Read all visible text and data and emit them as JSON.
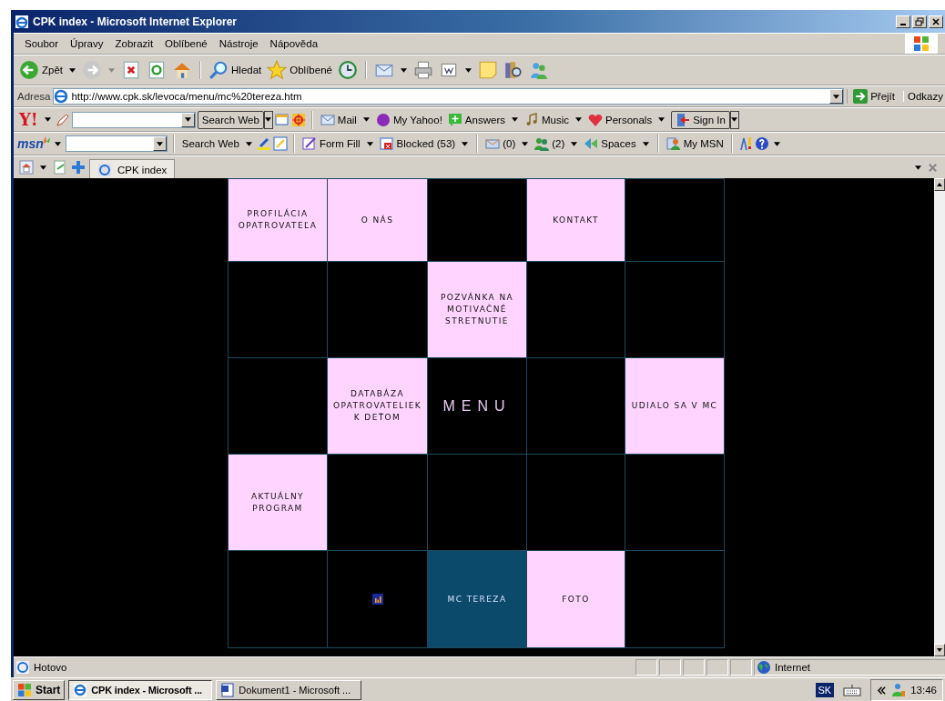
{
  "window": {
    "title": "CPK index - Microsoft Internet Explorer"
  },
  "menu": [
    "Soubor",
    "Úpravy",
    "Zobrazit",
    "Oblíbené",
    "Nástroje",
    "Nápověda"
  ],
  "toolbar": {
    "back": "Zpět",
    "search": "Hledat",
    "favorites": "Oblíbené"
  },
  "address": {
    "label": "Adresa",
    "value": "http://www.cpk.sk/levoca/menu/mc%20tereza.htm",
    "go": "Přejít",
    "links": "Odkazy"
  },
  "yahoo_bar": {
    "logo": "Y!",
    "search_button": "Search Web",
    "items": [
      "Mail",
      "My Yahoo!",
      "Answers",
      "Music",
      "Personals"
    ],
    "sign_in": "Sign In"
  },
  "msn_bar": {
    "logo": "msn",
    "search_button": "Search Web",
    "items": [
      "Form Fill",
      "Blocked (53)",
      "(0)",
      "(2)",
      "Spaces"
    ],
    "my_msn": "My MSN"
  },
  "tabs": [
    {
      "label": "CPK index",
      "selected": true
    }
  ],
  "grid": [
    [
      {
        "kind": "link",
        "text": "PROFILÁCIA OPATROVATEĽA"
      },
      {
        "kind": "link",
        "text": "O NÁS"
      },
      {
        "kind": "empty"
      },
      {
        "kind": "link",
        "text": "KONTAKT"
      },
      {
        "kind": "empty"
      }
    ],
    [
      {
        "kind": "empty"
      },
      {
        "kind": "empty"
      },
      {
        "kind": "link",
        "text": "POZVÁNKA NA MOTIVAČNÉ STRETNUTIE"
      },
      {
        "kind": "empty"
      },
      {
        "kind": "empty"
      }
    ],
    [
      {
        "kind": "empty"
      },
      {
        "kind": "link",
        "text": "DATABÁZA OPATROVATELIEK K DEŤOM"
      },
      {
        "kind": "heading",
        "text": "MENU"
      },
      {
        "kind": "empty"
      },
      {
        "kind": "link",
        "text": "UDIALO SA V MC"
      }
    ],
    [
      {
        "kind": "link",
        "text": "AKTUÁLNY PROGRAM"
      },
      {
        "kind": "empty"
      },
      {
        "kind": "empty"
      },
      {
        "kind": "empty"
      },
      {
        "kind": "empty"
      }
    ],
    [
      {
        "kind": "empty"
      },
      {
        "kind": "counter"
      },
      {
        "kind": "current",
        "text": "MC TEREZA"
      },
      {
        "kind": "link",
        "text": "FOTO"
      },
      {
        "kind": "empty"
      }
    ]
  ],
  "status_bar": {
    "text": "Hotovo",
    "zone": "Internet"
  },
  "taskbar": {
    "start": "Start",
    "tasks": [
      {
        "label": "CPK index - Microsoft ...",
        "selected": true
      },
      {
        "label": "Dokument1 - Microsoft ...",
        "selected": false
      }
    ],
    "language": "SK",
    "clock": "13:46"
  }
}
